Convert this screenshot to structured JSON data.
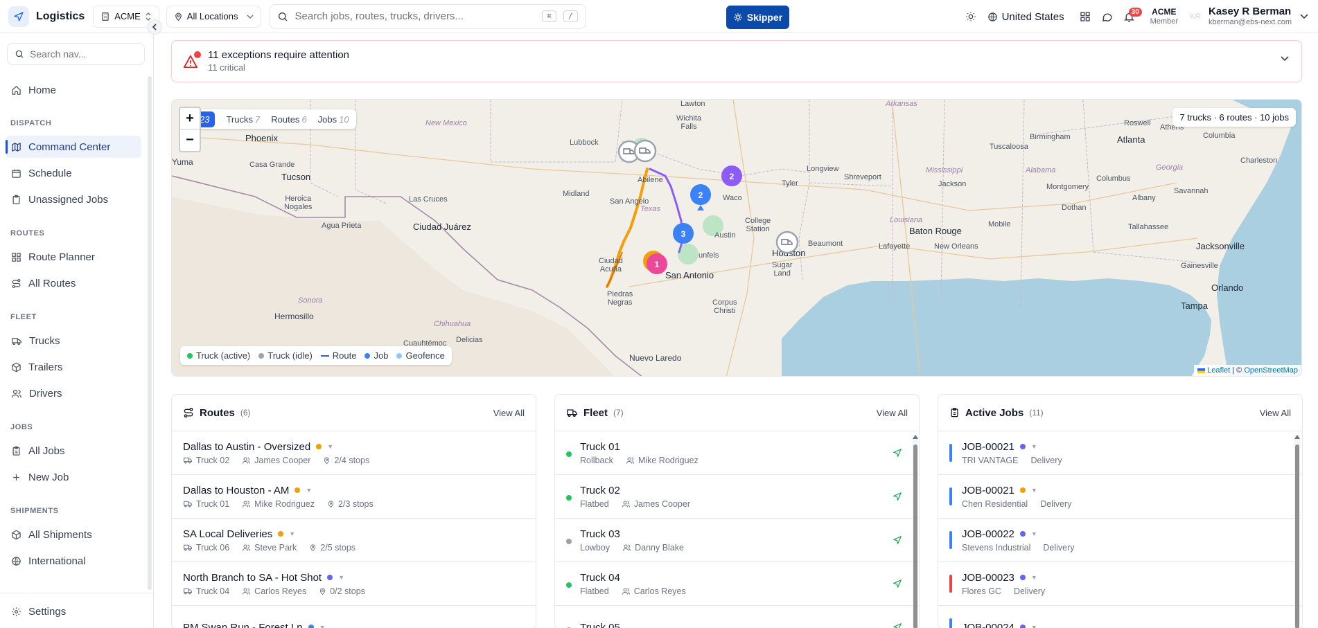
{
  "app": {
    "name": "Logistics",
    "org_selector": "ACME",
    "location_selector": "All Locations"
  },
  "search": {
    "placeholder": "Search jobs, routes, trucks, drivers...",
    "shortcut_key1": "⌘",
    "shortcut_key2": "/"
  },
  "assistant_button": "Skipper",
  "header": {
    "country": "United States",
    "notifications_count": "30",
    "org_name": "ACME",
    "org_role": "Member",
    "user_initials": "KR",
    "user_name": "Kasey R Berman",
    "user_email": "kberman@ebs-next.com"
  },
  "sidebar": {
    "search_placeholder": "Search nav...",
    "home": "Home",
    "sections": {
      "dispatch": "DISPATCH",
      "routes": "ROUTES",
      "fleet": "FLEET",
      "jobs": "JOBS",
      "shipments": "SHIPMENTS"
    },
    "items": {
      "command_center": "Command Center",
      "schedule": "Schedule",
      "unassigned_jobs": "Unassigned Jobs",
      "route_planner": "Route Planner",
      "all_routes": "All Routes",
      "trucks": "Trucks",
      "trailers": "Trailers",
      "drivers": "Drivers",
      "all_jobs": "All Jobs",
      "new_job": "New Job",
      "all_shipments": "All Shipments",
      "international": "International",
      "settings": "Settings"
    }
  },
  "alert": {
    "title": "11 exceptions require attention",
    "subtitle": "11 critical"
  },
  "map": {
    "filter_all_count": "23",
    "filters": [
      {
        "label": "Trucks",
        "count": "7"
      },
      {
        "label": "Routes",
        "count": "6"
      },
      {
        "label": "Jobs",
        "count": "10"
      }
    ],
    "summary": "7 trucks · 6 routes · 10 jobs",
    "legend": [
      "Truck (active)",
      "Truck (idle)",
      "Route",
      "Job",
      "Geofence"
    ],
    "attribution_leaflet": "Leaflet",
    "attribution_sep": " | © ",
    "attribution_osm": "OpenStreetMap",
    "labels": {
      "phoenix": "Phoenix",
      "yuma": "Yuma",
      "casa_grande": "Casa Grande",
      "tucson": "Tucson",
      "heroica_nogales": "Heroica\nNogales",
      "agua_prieta": "Agua Prieta",
      "hermosillo": "Hermosillo",
      "sonora": "Sonora",
      "new_mexico": "New Mexico",
      "las_cruces": "Las Cruces",
      "ciudad_juarez": "Ciudad Juárez",
      "chihuahua": "Chihuahua",
      "cuauhtemoc": "Cuauhtémoc",
      "delicias": "Delicias",
      "lubbock": "Lubbock",
      "midland": "Midland",
      "abilene": "Abilene",
      "san_angelo": "San Angelo",
      "texas": "Texas",
      "lawton": "Lawton",
      "wichita_falls": "Wichita\nFalls",
      "ciudad_acuna": "Ciudad\nAcuña",
      "piedras_negras": "Piedras\nNegras",
      "nuevo_laredo": "Nuevo Laredo",
      "san_antonio": "San Antonio",
      "new_braunfels": "unfels",
      "austin": "Austin",
      "waco": "Waco",
      "college_station": "College\nStation",
      "corpus_christi": "Corpus\nChristi",
      "tyler": "Tyler",
      "longview": "Longview",
      "shreveport": "Shreveport",
      "houston": "Houston",
      "sugar_land": "Sugar\nLand",
      "beaumont": "Beaumont",
      "lafayette": "Lafayette",
      "new_orleans": "New Orleans",
      "baton_rouge": "Baton Rouge",
      "louisiana": "Louisiana",
      "arkansas": "Arkansas",
      "mississippi": "Mississippi",
      "jackson": "Jackson",
      "alabama": "Alabama",
      "birmingham": "Birmingham",
      "tuscaloosa": "Tuscaloosa",
      "montgomery": "Montgomery",
      "mobile": "Mobile",
      "dothan": "Dothan",
      "tallahassee": "Tallahassee",
      "jacksonville": "Jacksonville",
      "gainesville": "Gainesville",
      "orlando": "Orlando",
      "tampa": "Tampa",
      "atlanta": "Atlanta",
      "georgia": "Georgia",
      "columbus": "Columbus",
      "albany": "Albany",
      "savannah": "Savannah",
      "charleston": "Charleston",
      "columbia": "Columbia",
      "roswell": "Roswell",
      "athens": "Athens"
    },
    "markers": [
      "1",
      "2",
      "3",
      "2"
    ]
  },
  "routes_card": {
    "title": "Routes",
    "count": "(6)",
    "view_all": "View All",
    "rows": [
      {
        "name": "Dallas to Austin - Oversized",
        "truck": "Truck 02",
        "driver": "James Cooper",
        "stops": "2/4 stops",
        "color": "#f59e0b"
      },
      {
        "name": "Dallas to Houston - AM",
        "truck": "Truck 01",
        "driver": "Mike Rodriguez",
        "stops": "2/3 stops",
        "color": "#f59e0b"
      },
      {
        "name": "SA Local Deliveries",
        "truck": "Truck 06",
        "driver": "Steve Park",
        "stops": "2/5 stops",
        "color": "#f59e0b"
      },
      {
        "name": "North Branch to SA - Hot Shot",
        "truck": "Truck 04",
        "driver": "Carlos Reyes",
        "stops": "0/2 stops",
        "color": "#6366f1"
      },
      {
        "name": "PM Swap Run - Forest Ln",
        "truck": "",
        "driver": "",
        "stops": "",
        "color": "#3b82f6"
      }
    ]
  },
  "fleet_card": {
    "title": "Fleet",
    "count": "(7)",
    "view_all": "View All",
    "rows": [
      {
        "name": "Truck 01",
        "type": "Rollback",
        "driver": "Mike Rodriguez",
        "status_color": "#22c55e"
      },
      {
        "name": "Truck 02",
        "type": "Flatbed",
        "driver": "James Cooper",
        "status_color": "#22c55e"
      },
      {
        "name": "Truck 03",
        "type": "Lowboy",
        "driver": "Danny Blake",
        "status_color": "#9ca3af"
      },
      {
        "name": "Truck 04",
        "type": "Flatbed",
        "driver": "Carlos Reyes",
        "status_color": "#22c55e"
      },
      {
        "name": "Truck 05",
        "type": "",
        "driver": "",
        "status_color": "#9ca3af"
      }
    ]
  },
  "jobs_card": {
    "title": "Active Jobs",
    "count": "(11)",
    "view_all": "View All",
    "rows": [
      {
        "id": "JOB-00021",
        "customer": "TRI VANTAGE",
        "type": "Delivery",
        "bar_color": "#3b82f6",
        "dot_color": "#6366f1"
      },
      {
        "id": "JOB-00021",
        "customer": "Chen Residential",
        "type": "Delivery",
        "bar_color": "#3b82f6",
        "dot_color": "#f59e0b"
      },
      {
        "id": "JOB-00022",
        "customer": "Stevens Industrial",
        "type": "Delivery",
        "bar_color": "#3b82f6",
        "dot_color": "#6366f1"
      },
      {
        "id": "JOB-00023",
        "customer": "Flores GC",
        "type": "Delivery",
        "bar_color": "#ef4444",
        "dot_color": "#6366f1"
      },
      {
        "id": "JOB-00024",
        "customer": "",
        "type": "",
        "bar_color": "#3b82f6",
        "dot_color": "#6366f1"
      }
    ]
  },
  "colors": {
    "brand": "#0b4aa8",
    "active_nav": "#eef2fb",
    "route_orange": "#f59e0b",
    "route_purple": "#8b5cf6",
    "job_blue": "#3b82f6",
    "water": "#a9cfe0",
    "land": "#f2efe9"
  }
}
